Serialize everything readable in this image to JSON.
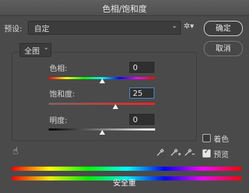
{
  "window": {
    "title": "色相/饱和度"
  },
  "preset": {
    "label": "预设:",
    "value": "自定"
  },
  "buttons": {
    "ok": "确定",
    "cancel": "取消"
  },
  "channel": {
    "value": "全图"
  },
  "sliders": [
    {
      "label": "色相:",
      "value": "0",
      "position": 0.5
    },
    {
      "label": "饱和度:",
      "value": "25",
      "position": 0.625
    },
    {
      "label": "明度:",
      "value": "0",
      "position": 0.5
    }
  ],
  "options": {
    "colorize": "着色",
    "colorize_checked": false,
    "preview": "预览",
    "preview_checked": true
  },
  "footer": {
    "overlay_text": "安全重"
  }
}
